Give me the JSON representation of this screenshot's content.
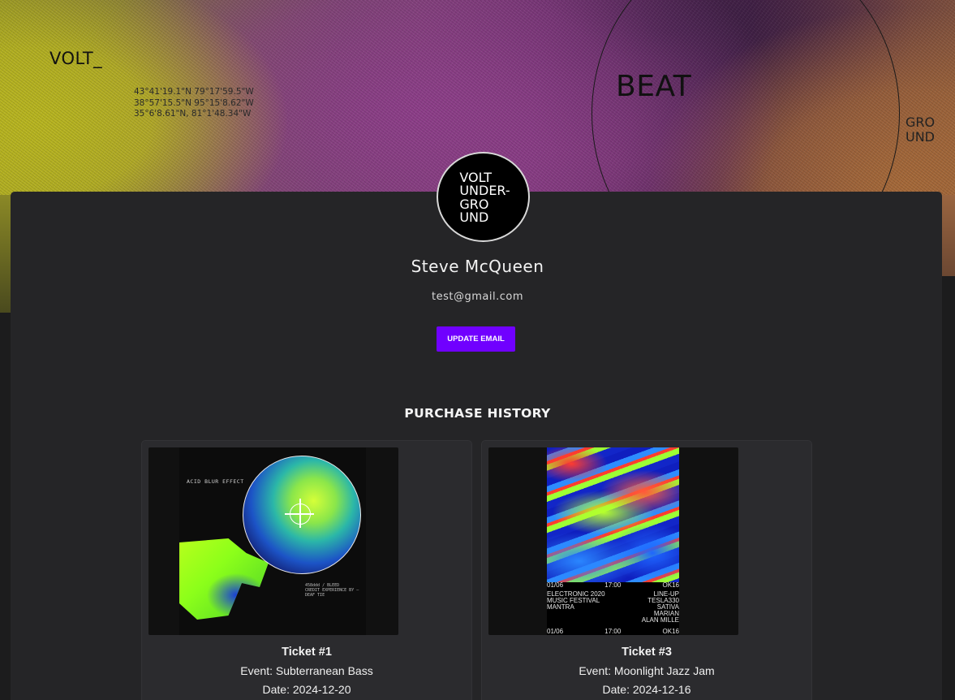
{
  "hero": {
    "logo_text": "VOLT_",
    "coordinates": [
      "43°41'19.1\"N 79°17'59.5\"W",
      "38°57'15.5\"N 95°15'8.62\"W",
      "35°6'8.61\"N, 81°1'48.34\"W"
    ],
    "beat_text": "BEAT",
    "ground_lines": [
      "GRO",
      "UND"
    ]
  },
  "profile": {
    "avatar_lines": [
      "VOLT",
      "UNDER-",
      "GRO",
      "UND"
    ],
    "name": "Steve McQueen",
    "email": "test@gmail.com",
    "update_email_label": "UPDATE EMAIL"
  },
  "purchase_history": {
    "title": "PURCHASE HISTORY",
    "tickets": [
      {
        "title": "Ticket #1",
        "event": "Event: Subterranean Bass",
        "date": "Date: 2024-12-20",
        "poster": {
          "label": "ACID BLUR EFFECT",
          "small_lines": [
            "458ddd / BLEED",
            "CREDIT EXPERIENCE BY — DEAF TIE"
          ]
        }
      },
      {
        "title": "Ticket #3",
        "event": "Event: Moonlight Jazz Jam",
        "date": "Date: 2024-12-16",
        "poster": {
          "top_row": [
            "01/06",
            "17:00",
            "OK16"
          ],
          "left_lines": [
            "ELECTRONIC 2020",
            "MUSIC FESTIVAL",
            "MANTRA"
          ],
          "right_lines": [
            "LINE-UP",
            "TESLA330",
            "SATIVA",
            "MARIAN",
            "ALAN MILLE"
          ],
          "bottom_row": [
            "01/06",
            "17:00",
            "OK16"
          ]
        }
      }
    ]
  },
  "colors": {
    "accent": "#7000ff",
    "page_background": "#1c1c1d",
    "card_background": "#252527"
  }
}
